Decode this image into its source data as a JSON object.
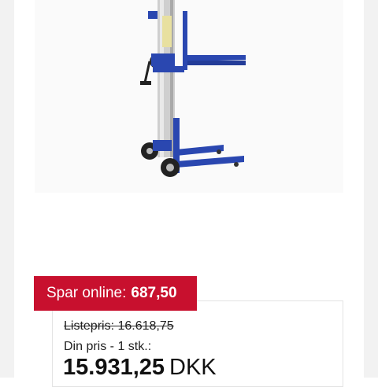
{
  "product": {
    "image_alt": "Manual material lift with hand crank winch and forks",
    "colors": {
      "frame": "#2a47b0",
      "mast": "#c8c8c8"
    }
  },
  "savings": {
    "label": "Spar online:",
    "amount": "687,50",
    "color": "#c8102e"
  },
  "pricing": {
    "list_price": "Listepris: 16.618,75",
    "your_price_label": "Din pris - 1 stk.:",
    "price": "15.931,25",
    "currency": "DKK"
  }
}
